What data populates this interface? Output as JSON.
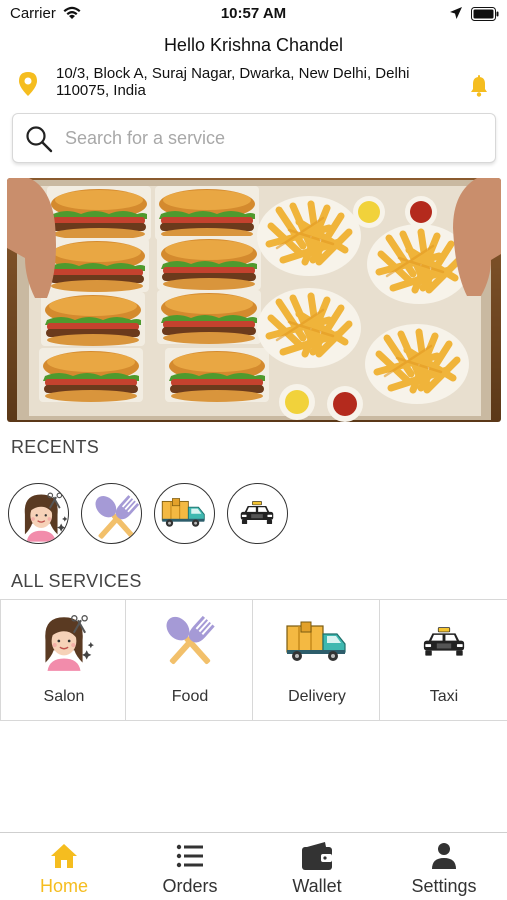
{
  "status_bar": {
    "carrier": "Carrier",
    "time": "10:57 AM"
  },
  "header": {
    "greeting": "Hello Krishna Chandel",
    "address": "10/3, Block A, Suraj Nagar, Dwarka, New Delhi, Delhi 110075, India"
  },
  "search": {
    "placeholder": "Search for a service"
  },
  "banner": {
    "icon": "burgers-and-fries-photo"
  },
  "recents": {
    "title": "RECENTS",
    "items": [
      {
        "icon": "salon-icon"
      },
      {
        "icon": "food-icon"
      },
      {
        "icon": "delivery-truck-icon"
      },
      {
        "icon": "taxi-icon"
      }
    ]
  },
  "services": {
    "title": "ALL SERVICES",
    "items": [
      {
        "label": "Salon",
        "icon": "salon-icon"
      },
      {
        "label": "Food",
        "icon": "food-icon"
      },
      {
        "label": "Delivery",
        "icon": "delivery-truck-icon"
      },
      {
        "label": "Taxi",
        "icon": "taxi-icon"
      }
    ]
  },
  "tabbar": {
    "active": "Home",
    "items": [
      {
        "label": "Home",
        "icon": "home-icon"
      },
      {
        "label": "Orders",
        "icon": "list-icon"
      },
      {
        "label": "Wallet",
        "icon": "wallet-icon"
      },
      {
        "label": "Settings",
        "icon": "person-icon"
      }
    ]
  },
  "colors": {
    "accent": "#f5bd1f",
    "text": "#222222",
    "border": "#d8d8d8"
  }
}
